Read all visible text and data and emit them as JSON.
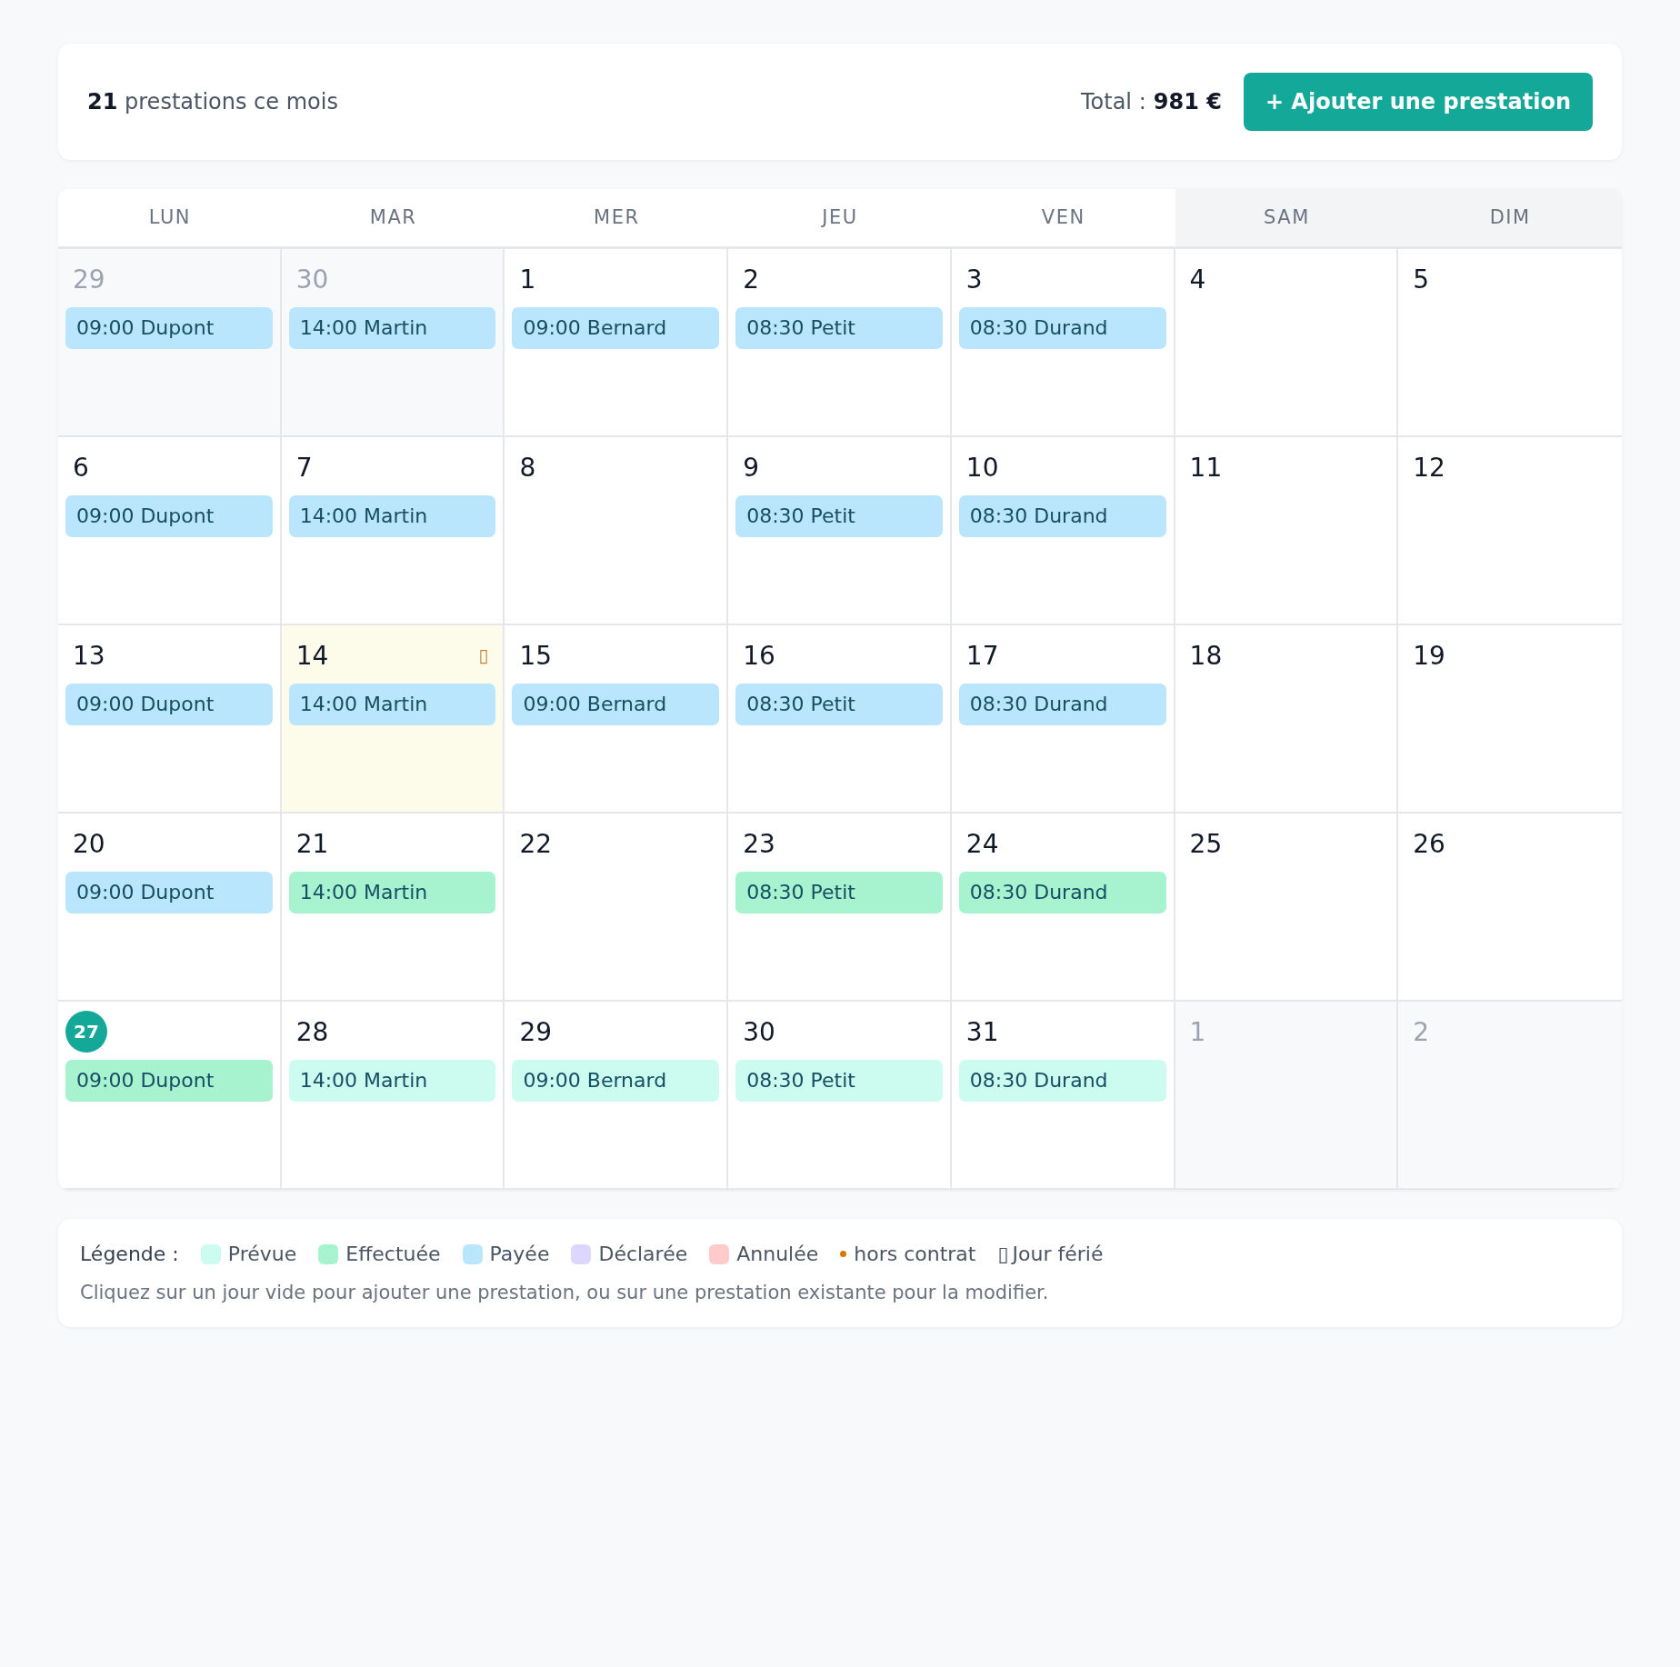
{
  "summary": {
    "count": "21",
    "count_label": "prestations ce mois",
    "total_label": "Total :",
    "total_value": "981 €",
    "add_button": "+ Ajouter une prestation"
  },
  "weekdays": [
    {
      "label": "LUN",
      "weekend": false
    },
    {
      "label": "MAR",
      "weekend": false
    },
    {
      "label": "MER",
      "weekend": false
    },
    {
      "label": "JEU",
      "weekend": false
    },
    {
      "label": "VEN",
      "weekend": false
    },
    {
      "label": "SAM",
      "weekend": true
    },
    {
      "label": "DIM",
      "weekend": true
    }
  ],
  "weeks": [
    [
      {
        "day": "29",
        "outside": true,
        "today": false,
        "holiday": false,
        "events": [
          {
            "text": "09:00 Dupont",
            "color": "#bae6fd"
          }
        ]
      },
      {
        "day": "30",
        "outside": true,
        "today": false,
        "holiday": false,
        "events": [
          {
            "text": "14:00 Martin",
            "color": "#bae6fd"
          }
        ]
      },
      {
        "day": "1",
        "outside": false,
        "today": false,
        "holiday": false,
        "events": [
          {
            "text": "09:00 Bernard",
            "color": "#bae6fd"
          }
        ]
      },
      {
        "day": "2",
        "outside": false,
        "today": false,
        "holiday": false,
        "events": [
          {
            "text": "08:30 Petit",
            "color": "#bae6fd"
          }
        ]
      },
      {
        "day": "3",
        "outside": false,
        "today": false,
        "holiday": false,
        "events": [
          {
            "text": "08:30 Durand",
            "color": "#bae6fd"
          }
        ]
      },
      {
        "day": "4",
        "outside": false,
        "today": false,
        "holiday": false
      },
      {
        "day": "5",
        "outside": false,
        "today": false,
        "holiday": false
      }
    ],
    [
      {
        "day": "6",
        "outside": false,
        "today": false,
        "holiday": false,
        "events": [
          {
            "text": "09:00 Dupont",
            "color": "#bae6fd"
          }
        ]
      },
      {
        "day": "7",
        "outside": false,
        "today": false,
        "holiday": false,
        "events": [
          {
            "text": "14:00 Martin",
            "color": "#bae6fd"
          }
        ]
      },
      {
        "day": "8",
        "outside": false,
        "today": false,
        "holiday": false
      },
      {
        "day": "9",
        "outside": false,
        "today": false,
        "holiday": false,
        "events": [
          {
            "text": "08:30 Petit",
            "color": "#bae6fd"
          }
        ]
      },
      {
        "day": "10",
        "outside": false,
        "today": false,
        "holiday": false,
        "events": [
          {
            "text": "08:30 Durand",
            "color": "#bae6fd"
          }
        ]
      },
      {
        "day": "11",
        "outside": false,
        "today": false,
        "holiday": false
      },
      {
        "day": "12",
        "outside": false,
        "today": false,
        "holiday": false
      }
    ],
    [
      {
        "day": "13",
        "outside": false,
        "today": false,
        "holiday": false,
        "events": [
          {
            "text": "09:00 Dupont",
            "color": "#bae6fd"
          }
        ]
      },
      {
        "day": "14",
        "outside": false,
        "today": false,
        "holiday": true,
        "holiday_icon": "▯",
        "events": [
          {
            "text": "14:00 Martin",
            "color": "#bae6fd"
          }
        ]
      },
      {
        "day": "15",
        "outside": false,
        "today": false,
        "holiday": false,
        "events": [
          {
            "text": "09:00 Bernard",
            "color": "#bae6fd"
          }
        ]
      },
      {
        "day": "16",
        "outside": false,
        "today": false,
        "holiday": false,
        "events": [
          {
            "text": "08:30 Petit",
            "color": "#bae6fd"
          }
        ]
      },
      {
        "day": "17",
        "outside": false,
        "today": false,
        "holiday": false,
        "events": [
          {
            "text": "08:30 Durand",
            "color": "#bae6fd"
          }
        ]
      },
      {
        "day": "18",
        "outside": false,
        "today": false,
        "holiday": false
      },
      {
        "day": "19",
        "outside": false,
        "today": false,
        "holiday": false
      }
    ],
    [
      {
        "day": "20",
        "outside": false,
        "today": false,
        "holiday": false,
        "events": [
          {
            "text": "09:00 Dupont",
            "color": "#bae6fd"
          }
        ]
      },
      {
        "day": "21",
        "outside": false,
        "today": false,
        "holiday": false,
        "events": [
          {
            "text": "14:00 Martin",
            "color": "#a7f3d0"
          }
        ]
      },
      {
        "day": "22",
        "outside": false,
        "today": false,
        "holiday": false
      },
      {
        "day": "23",
        "outside": false,
        "today": false,
        "holiday": false,
        "events": [
          {
            "text": "08:30 Petit",
            "color": "#a7f3d0"
          }
        ]
      },
      {
        "day": "24",
        "outside": false,
        "today": false,
        "holiday": false,
        "events": [
          {
            "text": "08:30 Durand",
            "color": "#a7f3d0"
          }
        ]
      },
      {
        "day": "25",
        "outside": false,
        "today": false,
        "holiday": false
      },
      {
        "day": "26",
        "outside": false,
        "today": false,
        "holiday": false
      }
    ],
    [
      {
        "day": "27",
        "outside": false,
        "today": true,
        "holiday": false,
        "events": [
          {
            "text": "09:00 Dupont",
            "color": "#a7f3d0"
          }
        ]
      },
      {
        "day": "28",
        "outside": false,
        "today": false,
        "holiday": false,
        "events": [
          {
            "text": "14:00 Martin",
            "color": "#ccfbef"
          }
        ]
      },
      {
        "day": "29",
        "outside": false,
        "today": false,
        "holiday": false,
        "events": [
          {
            "text": "09:00 Bernard",
            "color": "#ccfbef"
          }
        ]
      },
      {
        "day": "30",
        "outside": false,
        "today": false,
        "holiday": false,
        "events": [
          {
            "text": "08:30 Petit",
            "color": "#ccfbef"
          }
        ]
      },
      {
        "day": "31",
        "outside": false,
        "today": false,
        "holiday": false,
        "events": [
          {
            "text": "08:30 Durand",
            "color": "#ccfbef"
          }
        ]
      },
      {
        "day": "1",
        "outside": true,
        "today": false,
        "holiday": false
      },
      {
        "day": "2",
        "outside": true,
        "today": false,
        "holiday": false
      }
    ]
  ],
  "legend": {
    "title": "Légende :",
    "items": [
      {
        "kind": "swatch",
        "label": "Prévue",
        "color": "#ccfbef"
      },
      {
        "kind": "swatch",
        "label": "Effectuée",
        "color": "#a7f3d0"
      },
      {
        "kind": "swatch",
        "label": "Payée",
        "color": "#bae6fd"
      },
      {
        "kind": "swatch",
        "label": "Déclarée",
        "color": "#ddd6fe"
      },
      {
        "kind": "swatch",
        "label": "Annulée",
        "color": "#fecaca"
      },
      {
        "kind": "dot",
        "label": "hors contrat",
        "color": "#d97706"
      },
      {
        "kind": "glyph",
        "glyph": "▯",
        "label": "Jour férié"
      }
    ],
    "hint": "Cliquez sur un jour vide pour ajouter une prestation, ou sur une prestation existante pour la modifier."
  }
}
